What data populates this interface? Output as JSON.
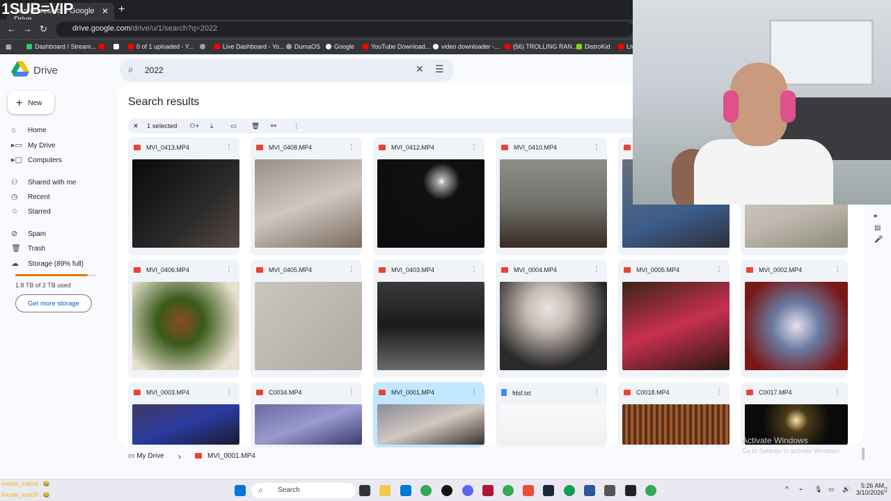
{
  "overlay": {
    "text": "1SUB=VIP"
  },
  "browser": {
    "tab_title": "Search results - Google Drive",
    "url_host": "drive.google.com",
    "url_path": "/drive/u/1/search?q=2022",
    "bookmarks": [
      "Dashboard / Stream...",
      "0 of 1 uploaded - Y...",
      "Live Dashboard - Yo...",
      "DumaOS",
      "Google",
      "YouTube Download...",
      "video downloader -...",
      "(56) TROLLING RAN...",
      "DistroKid",
      "Liv"
    ]
  },
  "drive": {
    "logo_text": "Drive",
    "search_query": "2022",
    "new_label": "New",
    "nav": {
      "home": "Home",
      "my_drive": "My Drive",
      "computers": "Computers",
      "shared": "Shared with me",
      "recent": "Recent",
      "starred": "Starred",
      "spam": "Spam",
      "trash": "Trash",
      "storage": "Storage (89% full)"
    },
    "storage_used_fraction": 0.89,
    "storage_text": "1.8 TB of 2 TB used",
    "get_more": "Get more storage",
    "title": "Search results",
    "selected_text": "1 selected",
    "files": [
      {
        "name": "MVI_0413.MP4",
        "type": "video"
      },
      {
        "name": "MVI_0408.MP4",
        "type": "video"
      },
      {
        "name": "MVI_0412.MP4",
        "type": "video"
      },
      {
        "name": "MVI_0410.MP4",
        "type": "video"
      },
      {
        "name": "",
        "type": "video"
      },
      {
        "name": "",
        "type": "video"
      },
      {
        "name": "MVI_0406.MP4",
        "type": "video"
      },
      {
        "name": "MVI_0405.MP4",
        "type": "video"
      },
      {
        "name": "MVI_0403.MP4",
        "type": "video"
      },
      {
        "name": "MVI_0004.MP4",
        "type": "video"
      },
      {
        "name": "MVI_0005.MP4",
        "type": "video"
      },
      {
        "name": "MVI_0002.MP4",
        "type": "video"
      },
      {
        "name": "MVI_0003.MP4",
        "type": "video"
      },
      {
        "name": "C0034.MP4",
        "type": "video"
      },
      {
        "name": "MVI_0001.MP4",
        "type": "video",
        "selected": true
      },
      {
        "name": "fdsf.txt",
        "type": "doc"
      },
      {
        "name": "C0018.MP4",
        "type": "video"
      },
      {
        "name": "C0017.MP4",
        "type": "video"
      }
    ],
    "breadcrumb_root": "My Drive",
    "breadcrumb_file": "MVI_0001.MP4",
    "watermark_title": "Activate Windows",
    "watermark_sub": "Go to Settings to activate Windows."
  },
  "taskbar": {
    "search": "Search",
    "time": "5:26 AM",
    "date": "3/10/2026"
  },
  "chat": [
    "hoodie_matt16 : 😂",
    "hoodie_matt16 : 😂"
  ],
  "colors": {
    "accent": "#0b57d0",
    "storage": "#e37400",
    "selected": "#c2e7ff"
  }
}
